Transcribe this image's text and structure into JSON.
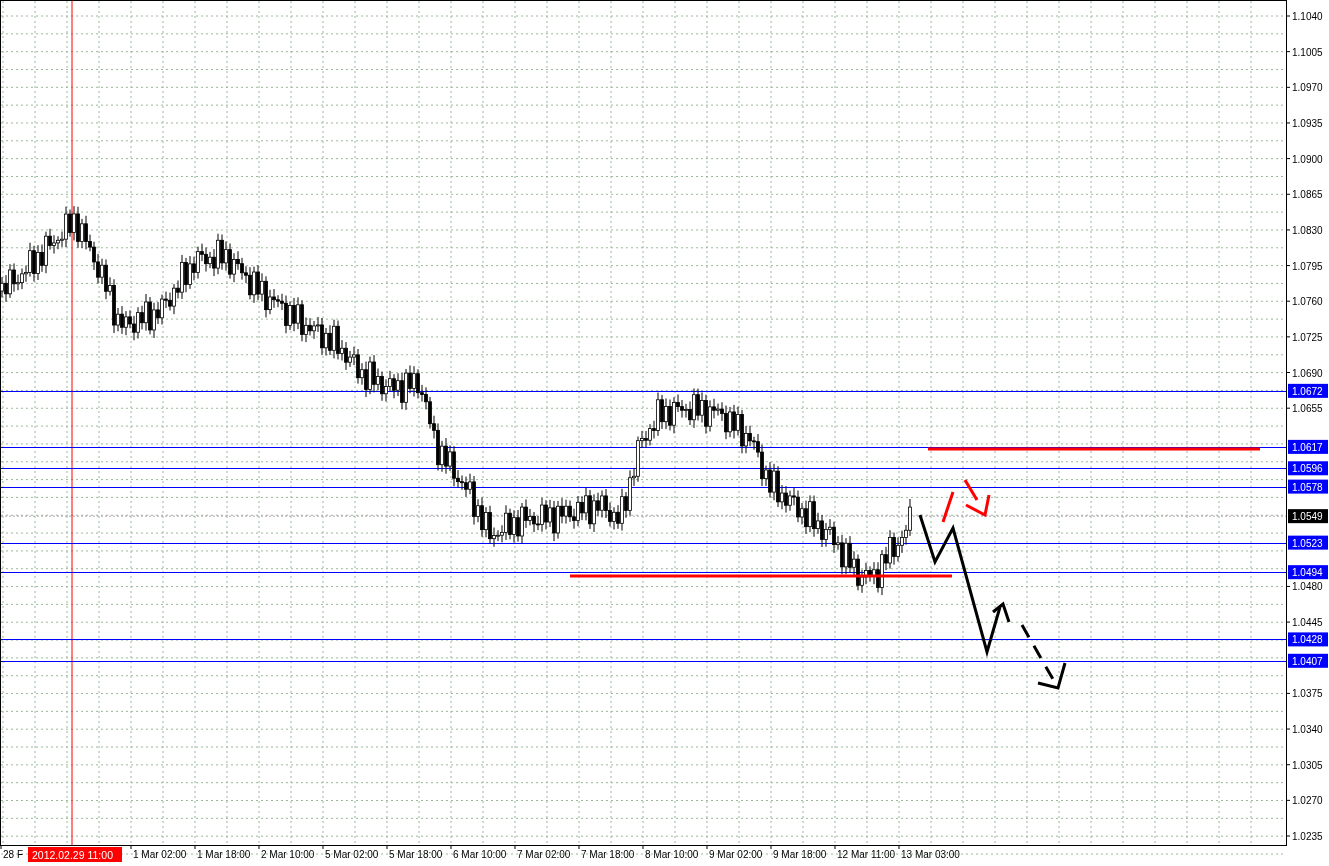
{
  "chart": {
    "price_ticks": [
      "1.1040",
      "1.1005",
      "1.0970",
      "1.0935",
      "1.0900",
      "1.0865",
      "1.0830",
      "1.0795",
      "1.0760",
      "1.0725",
      "1.0690",
      "1.0655",
      "1.0480",
      "1.0445",
      "1.0375",
      "1.0340",
      "1.0305",
      "1.0270",
      "1.0235"
    ],
    "time_ticks": [
      "28 F",
      "1 Mar 02:00",
      "1 Mar 18:00",
      "2 Mar 10:00",
      "5 Mar 02:00",
      "5 Mar 18:00",
      "6 Mar 10:00",
      "7 Mar 02:00",
      "7 Mar 18:00",
      "8 Mar 10:00",
      "9 Mar 02:00",
      "9 Mar 18:00",
      "12 Mar 11:00",
      "13 Mar 03:00"
    ],
    "levels": [
      {
        "price": "1.0672"
      },
      {
        "price": "1.0617"
      },
      {
        "price": "1.0596"
      },
      {
        "price": "1.0578"
      },
      {
        "price": "1.0523"
      },
      {
        "price": "1.0494"
      },
      {
        "price": "1.0428"
      },
      {
        "price": "1.0407"
      }
    ],
    "current_price": "1.0549",
    "cursor_time": "2012.02.29 11:00"
  }
}
